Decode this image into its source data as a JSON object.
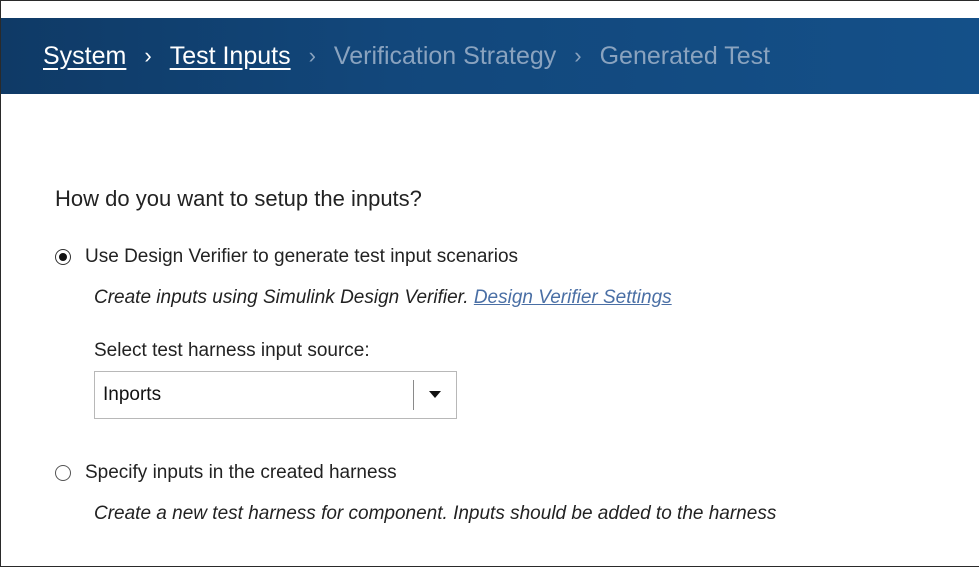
{
  "breadcrumb": {
    "steps": [
      {
        "label": "System",
        "active": true
      },
      {
        "label": "Test Inputs",
        "active": true
      },
      {
        "label": "Verification Strategy",
        "active": false
      },
      {
        "label": "Generated Test",
        "active": false
      }
    ],
    "separator": "›"
  },
  "question": "How do you want to setup the inputs?",
  "options": {
    "design_verifier": {
      "label": "Use Design Verifier to generate test input scenarios",
      "selected": true,
      "description": "Create inputs using Simulink Design Verifier.",
      "link": "Design Verifier Settings",
      "source_label": "Select test harness input source:",
      "source_value": "Inports"
    },
    "created_harness": {
      "label": "Specify inputs in the created harness",
      "selected": false,
      "description": "Create a new test harness for component. Inputs should be added to the harness"
    }
  },
  "colors": {
    "banner": "#12477b",
    "active_crumb": "#ffffff",
    "inactive_crumb": "#8aa3bf",
    "link": "#4a6fa5"
  },
  "icons": {
    "dropdown": "caret-down-icon"
  }
}
